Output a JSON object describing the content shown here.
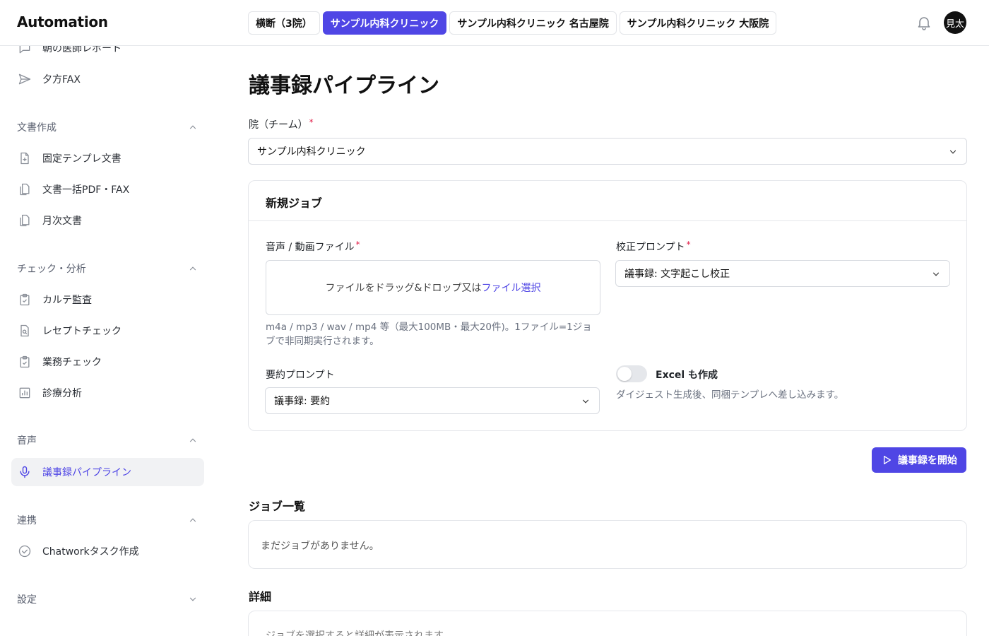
{
  "header": {
    "brand": "Automation",
    "tabs": [
      {
        "label": "横断（3院）",
        "active": false
      },
      {
        "label": "サンプル内科クリニック",
        "active": true
      },
      {
        "label": "サンプル内科クリニック 名古屋院",
        "active": false
      },
      {
        "label": "サンプル内科クリニック 大阪院",
        "active": false
      }
    ],
    "avatar_text": "見太",
    "bell_icon": "bell-icon"
  },
  "sidebar": {
    "top_items": [
      {
        "label": "朝の医師レポート",
        "icon": "chat-bubble-icon"
      },
      {
        "label": "夕方FAX",
        "icon": "send-icon"
      }
    ],
    "sections": [
      {
        "title": "文書作成",
        "expanded": true,
        "items": [
          {
            "label": "固定テンプレ文書",
            "icon": "file-plus-icon"
          },
          {
            "label": "文書一括PDF・FAX",
            "icon": "files-icon"
          },
          {
            "label": "月次文書",
            "icon": "files-icon"
          }
        ]
      },
      {
        "title": "チェック・分析",
        "expanded": true,
        "items": [
          {
            "label": "カルテ監査",
            "icon": "clipboard-check-icon"
          },
          {
            "label": "レセプトチェック",
            "icon": "file-search-icon"
          },
          {
            "label": "業務チェック",
            "icon": "clipboard-check-icon"
          },
          {
            "label": "診療分析",
            "icon": "bar-chart-icon"
          }
        ]
      },
      {
        "title": "音声",
        "expanded": true,
        "items": [
          {
            "label": "議事録パイプライン",
            "icon": "microphone-icon",
            "active": true
          }
        ]
      },
      {
        "title": "連携",
        "expanded": true,
        "items": [
          {
            "label": "Chatworkタスク作成",
            "icon": "check-circle-icon"
          }
        ]
      },
      {
        "title": "設定",
        "expanded": false,
        "items": []
      }
    ]
  },
  "main": {
    "title": "議事録パイプライン",
    "team_label": "院（チーム）",
    "team_required": "*",
    "team_value": "サンプル内科クリニック",
    "new_job": {
      "title": "新規ジョブ",
      "file_label": "音声 / 動画ファイル",
      "file_required": "*",
      "dropzone_text": "ファイルをドラッグ&ドロップ又は",
      "dropzone_link": "ファイル選択",
      "file_hint": "m4a / mp3 / wav / mp4 等（最大100MB・最大20件)。1ファイル=1ジョブで非同期実行されます。",
      "proofread_label": "校正プロンプト",
      "proofread_required": "*",
      "proofread_value": "議事録: 文字起こし校正",
      "summary_label": "要約プロンプト",
      "summary_value": "議事録: 要約",
      "excel_label": "Excel も作成",
      "excel_enabled": false,
      "excel_hint": "ダイジェスト生成後、同梱テンプレへ差し込みます。"
    },
    "start_button": "議事録を開始",
    "jobs_title": "ジョブ一覧",
    "jobs_empty": "まだジョブがありません。",
    "detail_title": "詳細",
    "detail_placeholder": "ジョブを選択すると詳細が表示されます。"
  },
  "colors": {
    "accent": "#4f46e5",
    "required": "#e11d48"
  }
}
